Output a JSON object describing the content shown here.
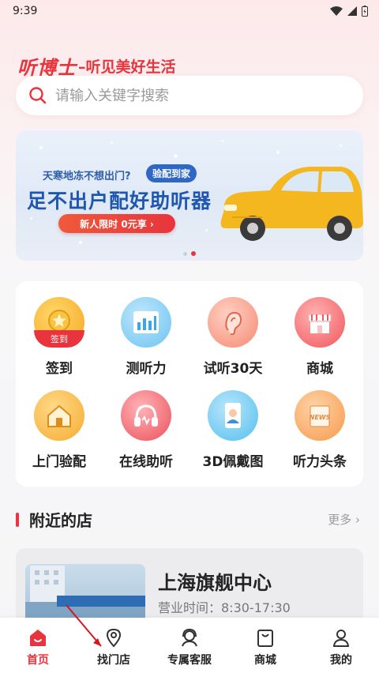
{
  "status_bar": {
    "time": "9:39"
  },
  "brand": {
    "logo": "听博士",
    "slogan": "–听见美好生活"
  },
  "search": {
    "placeholder": "请输入关键字搜索"
  },
  "banner": {
    "subtitle": "天寒地冻不想出门?",
    "tag": "验配到家",
    "title": "足不出户配好助听器",
    "cta": "新人限时 0元享 ›",
    "slide_count": 2,
    "active_slide": 2
  },
  "features": [
    {
      "label": "签到",
      "icon": "checkin-medal-icon",
      "badge": "签到"
    },
    {
      "label": "测听力",
      "icon": "hearing-test-chart-icon"
    },
    {
      "label": "试听30天",
      "icon": "ear-icon"
    },
    {
      "label": "商城",
      "icon": "shop-icon"
    },
    {
      "label": "上门验配",
      "icon": "home-visit-icon"
    },
    {
      "label": "在线助听",
      "icon": "headphones-icon"
    },
    {
      "label": "3D佩戴图",
      "icon": "3d-fitting-phone-icon"
    },
    {
      "label": "听力头条",
      "icon": "news-icon"
    }
  ],
  "nearby": {
    "title": "附近的店",
    "more": "更多 ›",
    "store": {
      "name": "上海旗舰中心",
      "hours": "营业时间：8:30-17:30"
    }
  },
  "tabbar": {
    "items": [
      {
        "label": "首页",
        "icon": "home-icon",
        "active": true
      },
      {
        "label": "找门店",
        "icon": "location-pin-icon",
        "active": false
      },
      {
        "label": "专属客服",
        "icon": "customer-service-icon",
        "active": false
      },
      {
        "label": "商城",
        "icon": "shopping-bag-icon",
        "active": false
      },
      {
        "label": "我的",
        "icon": "user-icon",
        "active": false
      }
    ]
  },
  "colors": {
    "accent": "#e8343c",
    "banner_blue": "#1f57b0"
  }
}
